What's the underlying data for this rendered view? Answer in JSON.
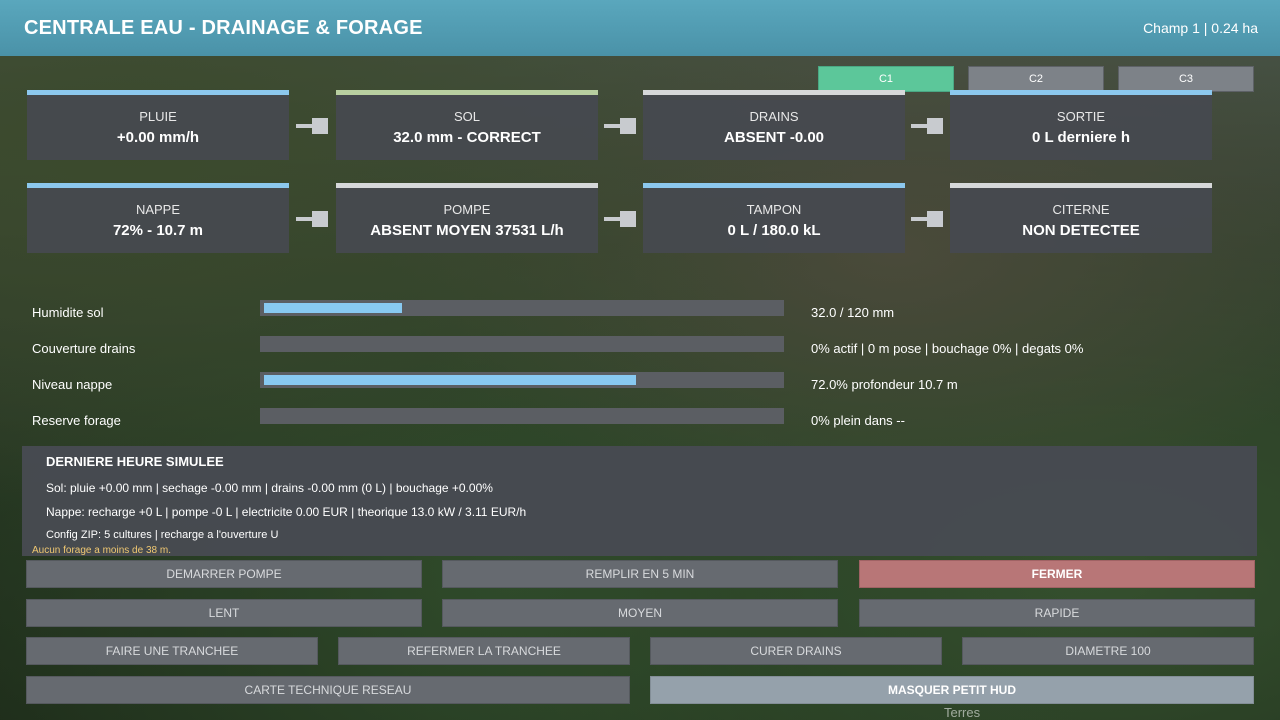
{
  "header": {
    "title": "CENTRALE EAU - DRAINAGE & FORAGE",
    "field_info": "Champ 1  |  0.24 ha"
  },
  "tabs": [
    {
      "label": "C1",
      "active": true
    },
    {
      "label": "C2",
      "active": false
    },
    {
      "label": "C3",
      "active": false
    }
  ],
  "cards_row1": [
    {
      "label": "PLUIE",
      "value": "+0.00 mm/h"
    },
    {
      "label": "SOL",
      "value": "32.0 mm - CORRECT"
    },
    {
      "label": "DRAINS",
      "value": "ABSENT -0.00"
    },
    {
      "label": "SORTIE",
      "value": "0 L derniere h"
    }
  ],
  "cards_row2": [
    {
      "label": "NAPPE",
      "value": "72% - 10.7 m"
    },
    {
      "label": "POMPE",
      "value": "ABSENT MOYEN 37531 L/h"
    },
    {
      "label": "TAMPON",
      "value": "0 L / 180.0 kL"
    },
    {
      "label": "CITERNE",
      "value": "NON DETECTEE"
    }
  ],
  "gauges": [
    {
      "label": "Humidite sol",
      "fill_fraction": 0.267,
      "value": "32.0 / 120 mm"
    },
    {
      "label": "Couverture drains",
      "fill_fraction": 0.0,
      "value": "0% actif | 0 m pose | bouchage 0% | degats 0%"
    },
    {
      "label": "Niveau nappe",
      "fill_fraction": 0.72,
      "value": "72.0%  profondeur 10.7 m"
    },
    {
      "label": "Reserve forage",
      "fill_fraction": 0.0,
      "value": "0%  plein dans --"
    }
  ],
  "simulation": {
    "title": "DERNIERE HEURE SIMULEE",
    "line1": "Sol: pluie +0.00 mm | sechage -0.00 mm | drains -0.00 mm (0 L) | bouchage +0.00%",
    "line2": "Nappe: recharge +0 L  |  pompe -0 L  |  electricite 0.00 EUR  |  theorique 13.0 kW / 3.11 EUR/h",
    "line3": "Config ZIP: 5 cultures | recharge a l'ouverture U"
  },
  "warning": "Aucun forage a moins de 38 m.",
  "buttons": {
    "start_pump": "DEMARRER POMPE",
    "fill_5min": "REMPLIR EN 5 MIN",
    "close": "FERMER",
    "slow": "LENT",
    "medium": "MOYEN",
    "fast": "RAPIDE",
    "dig_trench": "FAIRE UNE TRANCHEE",
    "close_trench": "REFERMER LA TRANCHEE",
    "clean_drains": "CURER DRAINS",
    "diameter": "DIAMETRE 100",
    "network_map": "CARTE TECHNIQUE RESEAU",
    "hide_hud": "MASQUER PETIT HUD"
  },
  "background_text": "Terres",
  "colors": {
    "header": "#5aa7bd",
    "active_tab": "#5cc79a",
    "gauge_fill": "#88c9f1",
    "danger_button": "#b87677",
    "warning_text": "#f0c872"
  }
}
